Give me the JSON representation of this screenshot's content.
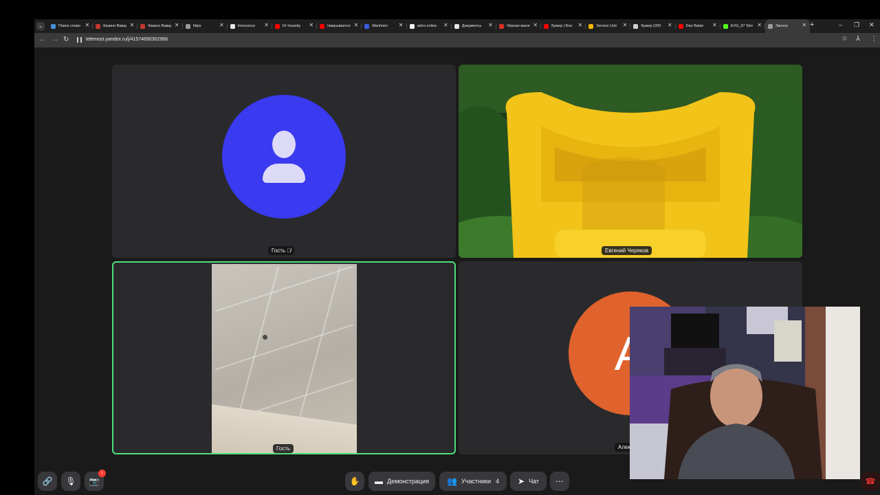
{
  "browser": {
    "tabs": [
      {
        "title": "Поиск слово",
        "favicon_color": "#4a90d9"
      },
      {
        "title": "Казино Вавада",
        "favicon_color": "#c0392b"
      },
      {
        "title": "Казино Вавада",
        "favicon_color": "#c0392b"
      },
      {
        "title": "https",
        "favicon_color": "#9a9a9a"
      },
      {
        "title": "Innocence",
        "favicon_color": "#e6e6e6"
      },
      {
        "title": "Dr Insanity",
        "favicon_color": "#ff0000"
      },
      {
        "title": "Накрывается",
        "favicon_color": "#ff0000"
      },
      {
        "title": "Manheim",
        "favicon_color": "#3b5bdb"
      },
      {
        "title": "astro-online",
        "favicon_color": "#f5f5f5"
      },
      {
        "title": "Документы",
        "favicon_color": "#e6e6e6"
      },
      {
        "title": "Чёрная магия",
        "favicon_color": "#d93025"
      },
      {
        "title": "Бумер | Бон",
        "favicon_color": "#ff0000"
      },
      {
        "title": "Service Unit",
        "favicon_color": "#f4b400"
      },
      {
        "title": "Бумер (200",
        "favicon_color": "#cfcfcf"
      },
      {
        "title": "Dan Balan",
        "favicon_color": "#ff0000"
      },
      {
        "title": "EVG_67 Stre",
        "favicon_color": "#53fc18"
      },
      {
        "title": "Звонок",
        "favicon_color": "#9a9a9a",
        "active": true
      }
    ],
    "url": "telemost.yandex.ru/j/41574690302966"
  },
  "tiles": {
    "guest1_name": "Гость",
    "evgeny_name": "Евгений Черяков",
    "guest2_name": "Гость",
    "alex_name": "Алек",
    "alex_initial": "А"
  },
  "controls": {
    "demo_label": "Демонстрация",
    "participants_label": "Участники",
    "participants_count": "4",
    "chat_label": "Чат",
    "notification_badge": "!"
  },
  "icons": {
    "link": "link-icon",
    "mic_off": "mic-off-icon",
    "camera_off": "camera-off-icon",
    "hand": "raise-hand-icon",
    "screen": "screen-share-icon",
    "people": "participants-icon",
    "chat": "chat-icon",
    "more": "more-icon",
    "hangup": "hang-up-icon"
  },
  "colors": {
    "active_speaker_border": "#4ee07a",
    "avatar_blue": "#3a3af0",
    "avatar_orange": "#e0622d",
    "hangup_red": "#e5322d"
  }
}
